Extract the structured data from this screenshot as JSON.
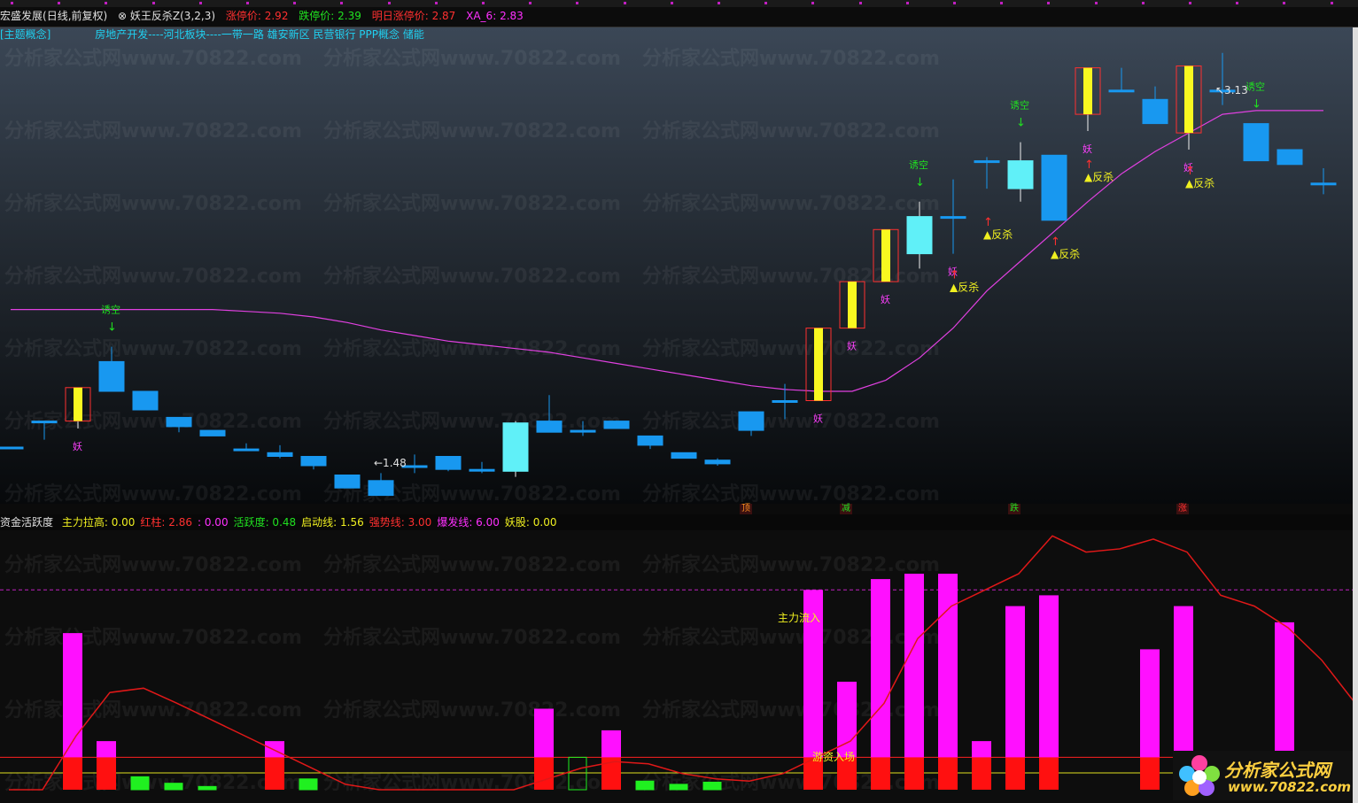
{
  "header": {
    "stock_name": "宏盛发展",
    "period_label": "(日线,前复权)",
    "indicator_name": "妖王反杀Z(3,2,3)",
    "limit_up_label": "涨停价:",
    "limit_up_value": "2.92",
    "limit_down_label": "跌停价:",
    "limit_down_value": "2.39",
    "next_limit_up_label": "明日涨停价:",
    "next_limit_up_value": "2.87",
    "xa6_label": "XA_6:",
    "xa6_value": "2.83"
  },
  "concepts": {
    "tag": "[主题概念]",
    "list": "房地产开发----河北板块----一带一路 雄安新区 民营银行 PPP概念 储能"
  },
  "watermark": "分析家公式网www.70822.com",
  "chart_data": [
    {
      "type": "candlestick",
      "title": "",
      "price_labels": {
        "low_mark": "1.48",
        "high_mark": "3.13"
      },
      "candles": [
        {
          "o": 1.86,
          "h": 1.86,
          "l": 1.86,
          "c": 1.86
        },
        {
          "o": 2.0,
          "h": 2.0,
          "l": 1.9,
          "c": 2.0
        },
        {
          "o": 2.0,
          "h": 2.18,
          "l": 1.96,
          "c": 2.18
        },
        {
          "o": 2.32,
          "h": 2.4,
          "l": 2.16,
          "c": 2.16
        },
        {
          "o": 2.16,
          "h": 2.16,
          "l": 2.06,
          "c": 2.06
        },
        {
          "o": 2.02,
          "h": 2.02,
          "l": 1.94,
          "c": 1.97
        },
        {
          "o": 1.95,
          "h": 1.95,
          "l": 1.92,
          "c": 1.92
        },
        {
          "o": 1.85,
          "h": 1.88,
          "l": 1.84,
          "c": 1.85
        },
        {
          "o": 1.83,
          "h": 1.87,
          "l": 1.8,
          "c": 1.81
        },
        {
          "o": 1.81,
          "h": 1.81,
          "l": 1.74,
          "c": 1.76
        },
        {
          "o": 1.71,
          "h": 1.71,
          "l": 1.64,
          "c": 1.64
        },
        {
          "o": 1.68,
          "h": 1.72,
          "l": 1.6,
          "c": 1.6
        },
        {
          "o": 1.76,
          "h": 1.82,
          "l": 1.72,
          "c": 1.76
        },
        {
          "o": 1.81,
          "h": 1.81,
          "l": 1.73,
          "c": 1.74
        },
        {
          "o": 1.74,
          "h": 1.78,
          "l": 1.72,
          "c": 1.74
        },
        {
          "o": 1.73,
          "h": 2.0,
          "l": 1.7,
          "c": 1.99
        },
        {
          "o": 2.0,
          "h": 2.14,
          "l": 1.94,
          "c": 1.94
        },
        {
          "o": 1.95,
          "h": 2.0,
          "l": 1.92,
          "c": 1.95
        },
        {
          "o": 2.0,
          "h": 2.0,
          "l": 1.96,
          "c": 1.96
        },
        {
          "o": 1.92,
          "h": 1.92,
          "l": 1.85,
          "c": 1.87
        },
        {
          "o": 1.83,
          "h": 1.83,
          "l": 1.8,
          "c": 1.8
        },
        {
          "o": 1.79,
          "h": 1.8,
          "l": 1.76,
          "c": 1.77
        },
        {
          "o": 2.05,
          "h": 2.05,
          "l": 1.92,
          "c": 1.95
        },
        {
          "o": 2.11,
          "h": 2.2,
          "l": 2.01,
          "c": 2.11
        },
        {
          "o": 2.11,
          "h": 2.5,
          "l": 2.11,
          "c": 2.5
        },
        {
          "o": 2.5,
          "h": 2.75,
          "l": 2.5,
          "c": 2.75
        },
        {
          "o": 2.75,
          "h": 3.03,
          "l": 2.75,
          "c": 3.03
        },
        {
          "o": 2.9,
          "h": 3.18,
          "l": 2.82,
          "c": 3.1
        },
        {
          "o": 3.1,
          "h": 3.3,
          "l": 2.9,
          "c": 3.1
        },
        {
          "o": 3.4,
          "h": 3.42,
          "l": 3.25,
          "c": 3.4
        },
        {
          "o": 3.25,
          "h": 3.5,
          "l": 3.18,
          "c": 3.4
        },
        {
          "o": 3.43,
          "h": 3.43,
          "l": 3.08,
          "c": 3.08
        },
        {
          "o": 3.65,
          "h": 3.9,
          "l": 3.56,
          "c": 3.9
        },
        {
          "o": 3.78,
          "h": 3.9,
          "l": 3.78,
          "c": 3.78
        },
        {
          "o": 3.73,
          "h": 3.8,
          "l": 3.6,
          "c": 3.6
        },
        {
          "o": 3.55,
          "h": 3.91,
          "l": 3.46,
          "c": 3.91
        },
        {
          "o": 3.78,
          "h": 3.98,
          "l": 3.7,
          "c": 3.78
        },
        {
          "o": 3.6,
          "h": 3.6,
          "l": 3.4,
          "c": 3.4
        },
        {
          "o": 3.46,
          "h": 3.46,
          "l": 3.38,
          "c": 3.38
        },
        {
          "o": 3.28,
          "h": 3.36,
          "l": 3.22,
          "c": 3.28
        }
      ],
      "ma_line": [
        2.6,
        2.6,
        2.6,
        2.6,
        2.6,
        2.6,
        2.6,
        2.59,
        2.58,
        2.56,
        2.53,
        2.49,
        2.46,
        2.43,
        2.41,
        2.39,
        2.37,
        2.34,
        2.31,
        2.28,
        2.25,
        2.22,
        2.19,
        2.17,
        2.16,
        2.16,
        2.22,
        2.34,
        2.5,
        2.7,
        2.86,
        3.02,
        3.18,
        3.33,
        3.45,
        3.55,
        3.65,
        3.67,
        3.67,
        3.67
      ],
      "annotations": {
        "yao_label": "妖",
        "lure_short_label": "诱空",
        "counter_kill_label": "▲反杀",
        "yao_at": [
          2,
          24,
          25,
          26,
          28,
          32,
          35
        ],
        "lure_at": [
          3,
          27,
          30,
          37
        ],
        "counter_at": [
          28,
          29,
          31,
          32,
          35
        ]
      }
    },
    {
      "type": "bar",
      "title": "资金活跃度",
      "legend": [
        {
          "label": "主力拉高:",
          "value": "0.00",
          "color": "#f0f020"
        },
        {
          "label": "红柱:",
          "value": "2.86",
          "color": "#ff3030"
        },
        {
          "label": ":",
          "value": "0.00",
          "color": "#ff30ff"
        },
        {
          "label": "活跃度:",
          "value": "0.48",
          "color": "#20e020"
        },
        {
          "label": "启动线:",
          "value": "1.56",
          "color": "#f0f020"
        },
        {
          "label": "强势线:",
          "value": "3.00",
          "color": "#ff3030"
        },
        {
          "label": "爆发线:",
          "value": "6.00",
          "color": "#ff30ff"
        },
        {
          "label": "妖股:",
          "value": "0.00",
          "color": "#f0f020"
        }
      ],
      "text_annotations": {
        "main_inflow": "主力流入",
        "hot_money": "游资入场"
      },
      "y_levels": {
        "start_line": 1.56,
        "strong_line": 3.0,
        "burst_line": 6.0
      },
      "magenta_bars": [
        0,
        0,
        14.5,
        4.5,
        0,
        0,
        0,
        0,
        4.5,
        0,
        0,
        0,
        0,
        0,
        0,
        0,
        7.5,
        0,
        5.5,
        0,
        0,
        0,
        0,
        0,
        18.5,
        10,
        19.5,
        20,
        20,
        4.5,
        17,
        18,
        0,
        0,
        13,
        17,
        0,
        0,
        15.5,
        0
      ],
      "red_bars": [
        0,
        0,
        3,
        3,
        0,
        0,
        0,
        0,
        3,
        0,
        0,
        0,
        0,
        0,
        0,
        0,
        3,
        0,
        3,
        0,
        0,
        0,
        0,
        0,
        3,
        3,
        3,
        3,
        3,
        3,
        3,
        3,
        0,
        0,
        3,
        3,
        0,
        0,
        3,
        0
      ],
      "green_bars": [
        0,
        0,
        0,
        0,
        1.2,
        0.6,
        0.3,
        0,
        0,
        1.0,
        0,
        0,
        0,
        0,
        0,
        0,
        0,
        3,
        0,
        0.8,
        0.5,
        0.7,
        0,
        0,
        0,
        0,
        0,
        0,
        0,
        0,
        0,
        0,
        0,
        0,
        0,
        0,
        2.5,
        1.3,
        0,
        0
      ],
      "line": [
        0,
        0,
        5,
        9,
        9.4,
        8,
        6.5,
        5,
        3.5,
        2,
        0.5,
        0,
        0,
        0,
        0,
        0,
        1,
        2,
        2.6,
        2.4,
        1.5,
        1,
        0.8,
        1.5,
        3,
        4.5,
        8,
        14,
        17,
        18.5,
        20,
        23.5,
        22,
        22.3,
        23.2,
        22,
        18,
        17,
        15,
        12,
        8,
        5,
        2.5
      ]
    }
  ],
  "separator_tags": [
    {
      "label": "顶",
      "color": "#ff9020"
    },
    {
      "label": "减",
      "color": "#20e020"
    },
    {
      "label": "跌",
      "color": "#20e020"
    },
    {
      "label": "涨",
      "color": "#ff3030"
    }
  ],
  "logo": {
    "line1": "分析家公式网",
    "line2": "www.70822.com"
  }
}
